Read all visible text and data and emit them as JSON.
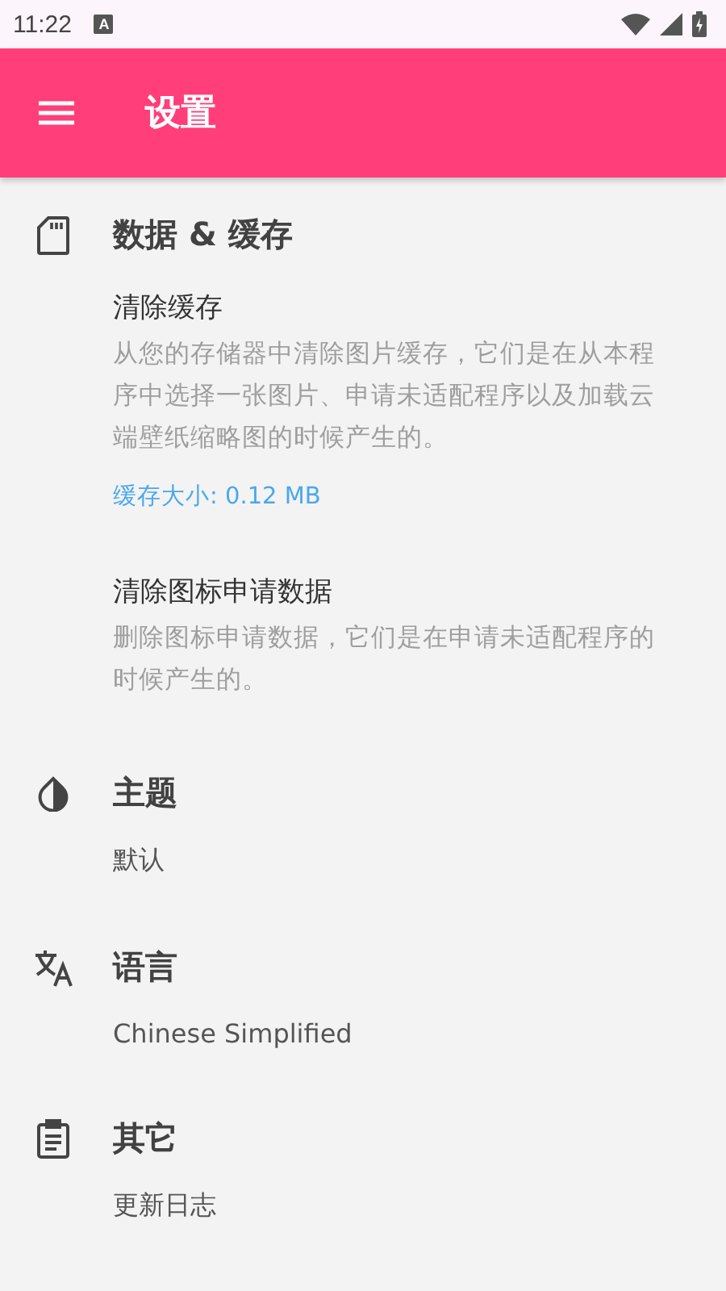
{
  "status_bar": {
    "time": "11:22",
    "notification": "A"
  },
  "app_bar": {
    "title": "设置"
  },
  "sections": [
    {
      "kind": "storage",
      "title": "数据 & 缓存",
      "items": [
        {
          "title": "清除缓存",
          "summary": "从您的存储器中清除图片缓存，它们是在从本程序中选择一张图片、申请未适配程序以及加载云端壁纸缩略图的时候产生的。",
          "note": "缓存大小: 0.12 MB"
        },
        {
          "title": "清除图标申请数据",
          "summary": "删除图标申请数据，它们是在申请未适配程序的时候产生的。"
        }
      ]
    },
    {
      "kind": "theme",
      "title": "主题",
      "items": [
        {
          "value": "默认"
        }
      ]
    },
    {
      "kind": "language",
      "title": "语言",
      "items": [
        {
          "value": "Chinese Simplified"
        }
      ]
    },
    {
      "kind": "other",
      "title": "其它",
      "items": [
        {
          "value": "更新日志"
        }
      ]
    }
  ]
}
